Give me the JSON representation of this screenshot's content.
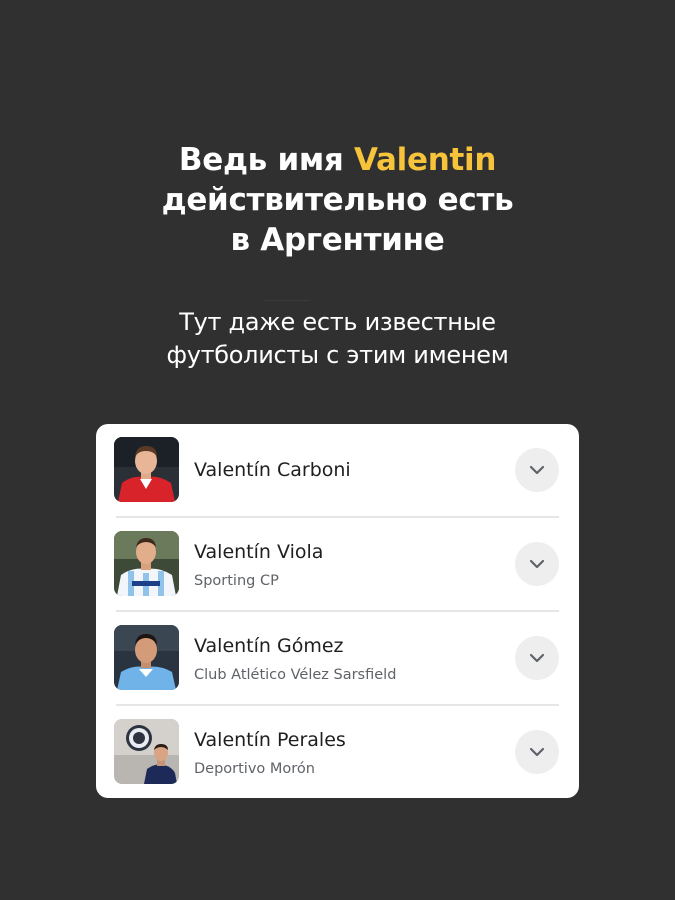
{
  "headline": {
    "line1_prefix": "Ведь имя ",
    "line1_accent": "Valentin",
    "line2": "действительно есть",
    "line3": "в Аргентине"
  },
  "subtitle": {
    "line1": "Тут даже есть известные",
    "line2": "футболисты с этим именем"
  },
  "colors": {
    "background": "#303030",
    "accent": "#f7c33b",
    "card": "#ffffff"
  },
  "players": [
    {
      "name": "Valentín Carboni",
      "club": "",
      "icon": "chevron-down-icon"
    },
    {
      "name": "Valentín Viola",
      "club": "Sporting CP",
      "icon": "chevron-down-icon"
    },
    {
      "name": "Valentín Gómez",
      "club": "Club Atlético Vélez Sarsfield",
      "icon": "chevron-down-icon"
    },
    {
      "name": "Valentín Perales",
      "club": "Deportivo Morón",
      "icon": "chevron-down-icon"
    }
  ]
}
